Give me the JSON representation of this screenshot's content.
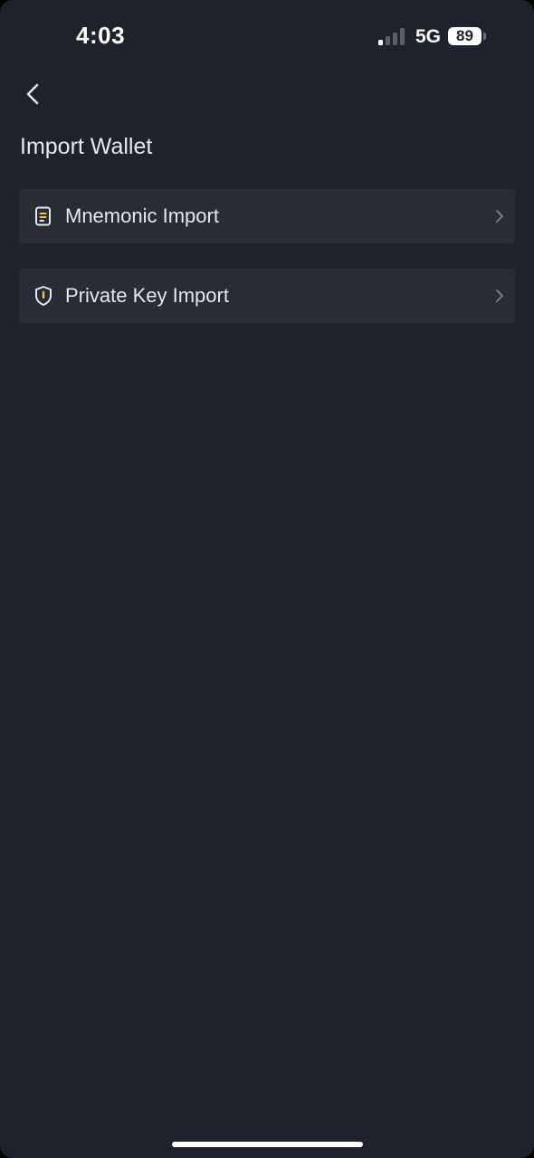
{
  "status_bar": {
    "time": "4:03",
    "network": "5G",
    "battery": "89",
    "signal_bars_active": 1,
    "signal_bars_total": 4
  },
  "header": {
    "back_icon": "chevron-left-icon",
    "title": "Import Wallet"
  },
  "options": [
    {
      "label": "Mnemonic Import",
      "icon": "document-icon",
      "trailing_icon": "chevron-right-icon"
    },
    {
      "label": "Private Key Import",
      "icon": "shield-key-icon",
      "trailing_icon": "chevron-right-icon"
    }
  ],
  "colors": {
    "background": "#1f222a",
    "card": "#282c33",
    "text": "#e6e8ec",
    "accent": "#f0c93a",
    "chevron": "#7d818a"
  }
}
